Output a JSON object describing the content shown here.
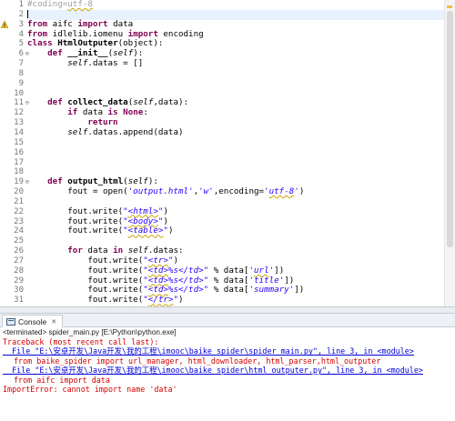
{
  "colors": {
    "keyword": "#7f0055",
    "string": "#2a00ff",
    "comment": "#3f7f5f",
    "error_text": "#d40000",
    "link_text": "#0000d8",
    "current_line": "#e8f2fe"
  },
  "editor": {
    "line_numbers": [
      "1",
      "2",
      "3",
      "4",
      "5",
      "6",
      "7",
      "8",
      "9",
      "10",
      "11",
      "12",
      "13",
      "14",
      "15",
      "16",
      "17",
      "18",
      "19",
      "20",
      "21",
      "22",
      "23",
      "24",
      "25",
      "26",
      "27",
      "28",
      "29",
      "30",
      "31"
    ],
    "gutter_icons": {
      "3": "warning-icon",
      "6": "fold-collapse-icon",
      "11": "fold-collapse-icon",
      "19": "fold-collapse-icon"
    },
    "lines": [
      "#coding=utf-8",
      "",
      "from aifc import data",
      "from idlelib.iomenu import encoding",
      "class HtmlOutputer(object):",
      "    def __init__(self):",
      "        self.datas = []",
      "",
      "",
      "",
      "    def collect_data(self,data):",
      "        if data is None:",
      "            return",
      "        self.datas.append(data)",
      "",
      "",
      "",
      "",
      "    def output_html(self):",
      "        fout = open('output.html','w',encoding='utf-8')",
      "",
      "        fout.write(\"<html>\")",
      "        fout.write(\"<body>\")",
      "        fout.write(\"<table>\")",
      "",
      "        for data in self.datas:",
      "            fout.write(\"<tr>\")",
      "            fout.write(\"<td>%s</td>\" % data['url'])",
      "            fout.write(\"<td>%s</td>\" % data['title'])",
      "            fout.write(\"<td>%s</td>\" % data['summary'])",
      "            fout.write(\"</tr>\")"
    ]
  },
  "console": {
    "tab_label": "Console",
    "tab_close": "✕",
    "status": "<terminated> spider_main.py [E:\\Python\\python.exe]",
    "output": [
      {
        "type": "error",
        "text": "Traceback (most recent call last):"
      },
      {
        "type": "link",
        "text": "  File \"E:\\安卓开发\\Java开发\\我的工程\\imooc\\baike_spider\\spider_main.py\", line 3, in <module>"
      },
      {
        "type": "error-indent",
        "text": "from baike_spider import url_manager, html_downloader, html_parser,html_outputer"
      },
      {
        "type": "link",
        "text": "  File \"E:\\安卓开发\\Java开发\\我的工程\\imooc\\baike_spider\\html_outputer.py\", line 3, in <module>"
      },
      {
        "type": "error-indent",
        "text": "from aifc import data"
      },
      {
        "type": "error",
        "text": "ImportError: cannot import name 'data'"
      }
    ]
  }
}
